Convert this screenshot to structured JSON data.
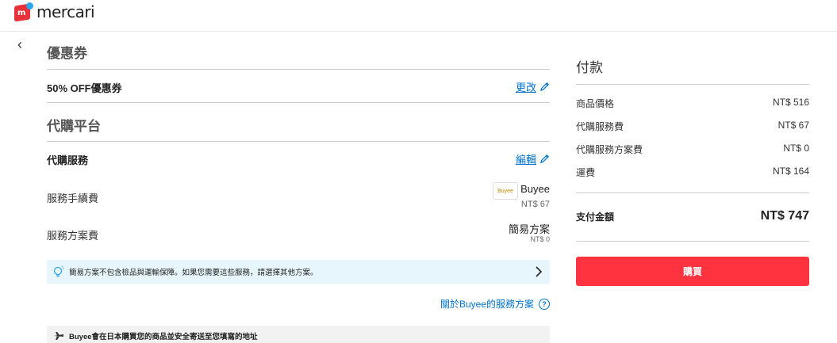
{
  "header": {
    "logo_text": "mercari",
    "logo_mark": "m"
  },
  "nav": {
    "back_glyph": "‹"
  },
  "coupon": {
    "section_title": "優惠券",
    "label": "50% OFF優惠券",
    "change_link": "更改"
  },
  "proxy": {
    "section_title": "代購平台",
    "service_label": "代購服務",
    "edit_link": "編輯",
    "fee_label": "服務手續費",
    "provider_badge": "Buyee",
    "provider_name": "Buyee",
    "provider_fee": "NT$ 67",
    "plan_label": "服務方案費",
    "plan_name": "簡易方案",
    "plan_fee": "NT$ 0",
    "notice_text": "簡易方案不包含檢品與運輸保障。如果您需要這些服務，請選擇其他方案。",
    "plan_info_link": "關於Buyee的服務方案",
    "shipping_note": "Buyee會在日本購買您的商品並安全寄送至您填寫的地址"
  },
  "payment": {
    "title": "付款",
    "rows": [
      {
        "label": "商品價格",
        "value": "NT$ 516"
      },
      {
        "label": "代購服務費",
        "value": "NT$ 67"
      },
      {
        "label": "代購服務方案費",
        "value": "NT$ 0"
      },
      {
        "label": "運費",
        "value": "NT$ 164"
      }
    ],
    "total_label": "支付金額",
    "total_value": "NT$ 747",
    "buy_button": "購買"
  },
  "colors": {
    "accent": "#ff333f",
    "link": "#0073cc",
    "notice_bg": "#e7f5fc"
  }
}
